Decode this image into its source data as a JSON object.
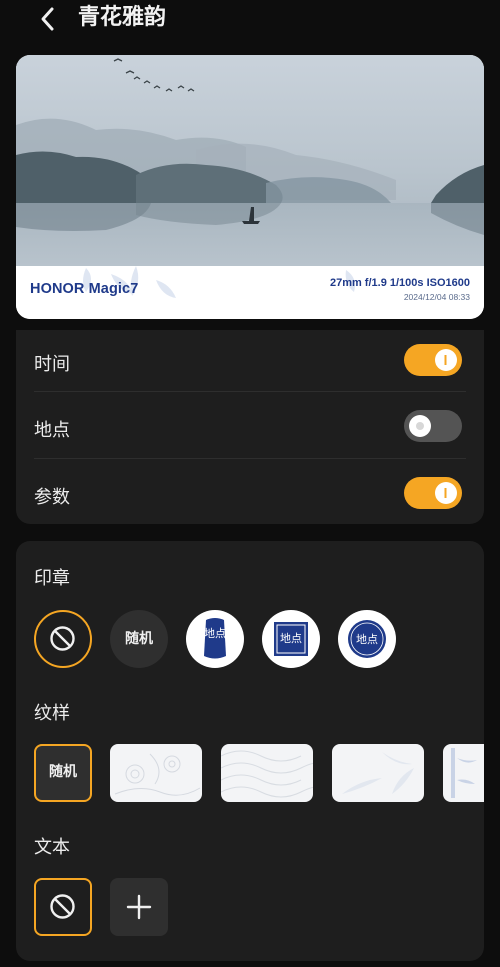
{
  "header": {
    "title": "青花雅韵"
  },
  "preview": {
    "brand": "HONOR Magic7",
    "params": "27mm  f/1.9  1/100s  ISO1600",
    "datetime": "2024/12/04 08:33"
  },
  "toggles": [
    {
      "label": "时间",
      "on": true
    },
    {
      "label": "地点",
      "on": false
    },
    {
      "label": "参数",
      "on": true
    }
  ],
  "stamp": {
    "title": "印章",
    "random_label": "随机",
    "seals": [
      {
        "text": "地点",
        "icon": "vertical-seal"
      },
      {
        "text": "地点",
        "icon": "square-seal"
      },
      {
        "text": "地点",
        "icon": "round-seal"
      }
    ]
  },
  "pattern": {
    "title": "纹样",
    "random_label": "随机"
  },
  "text_section": {
    "title": "文本"
  },
  "colors": {
    "accent": "#f5a623",
    "seal_blue": "#1f3a8a",
    "card": "#1e1e1e"
  }
}
